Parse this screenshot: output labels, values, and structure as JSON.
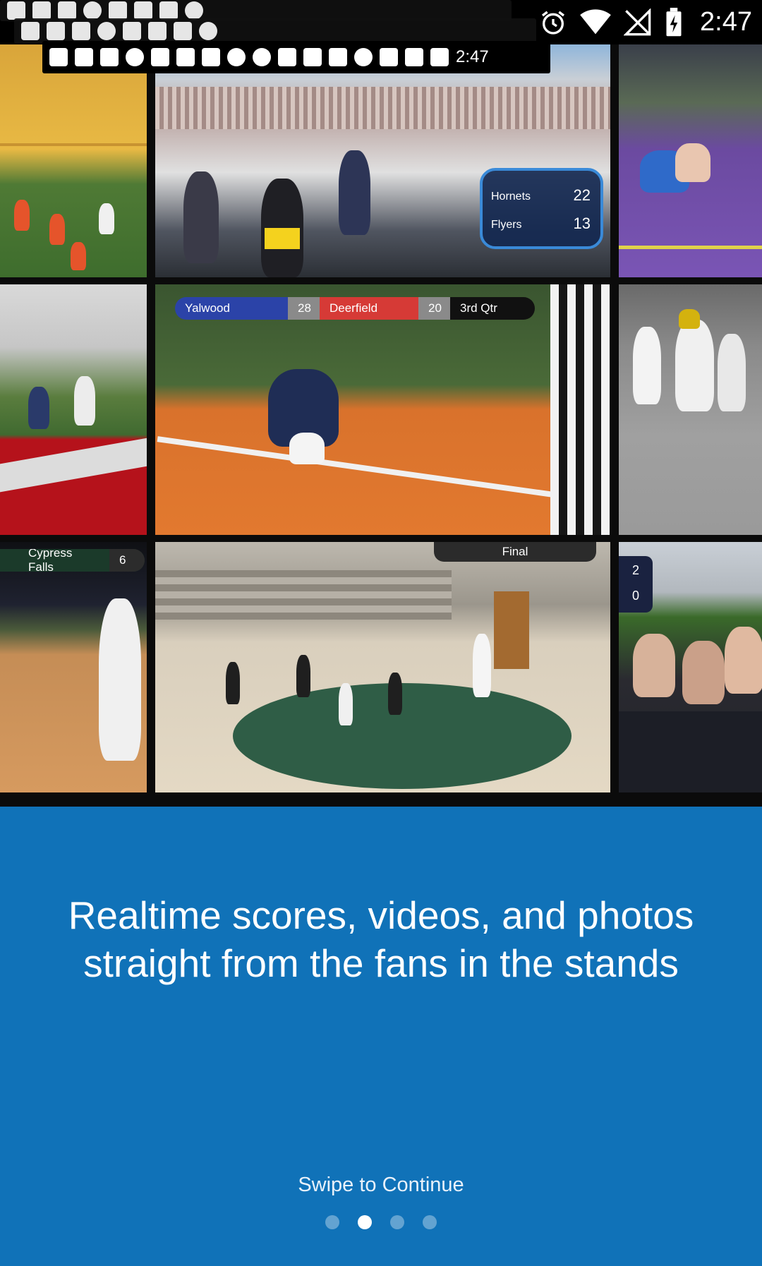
{
  "status_bar": {
    "time": "2:47",
    "ghost_time": "2:47",
    "icons": [
      "alarm-icon",
      "wifi-icon",
      "no-signal-icon",
      "battery-charging-icon"
    ]
  },
  "collage": {
    "overlays": {
      "hornets_team": "Hornets",
      "hornets_score": "22",
      "flyers_team": "Flyers",
      "flyers_score": "13",
      "home_team": "Yalwood",
      "home_score": "28",
      "away_team": "Deerfield",
      "away_score": "20",
      "period": "3rd Qtr",
      "cypress_team": "Cypress Falls",
      "cypress_score": "6",
      "final_label": "Final",
      "side_score_top": "2",
      "side_score_bottom": "0"
    }
  },
  "onboarding": {
    "headline_line1": "Realtime scores, videos, and photos",
    "headline_line2": "straight from the fans in the stands",
    "swipe_label": "Swipe to Continue",
    "page_count": 4,
    "active_page": 2
  },
  "colors": {
    "panel_bg": "#1072b8",
    "text": "#ffffff"
  }
}
